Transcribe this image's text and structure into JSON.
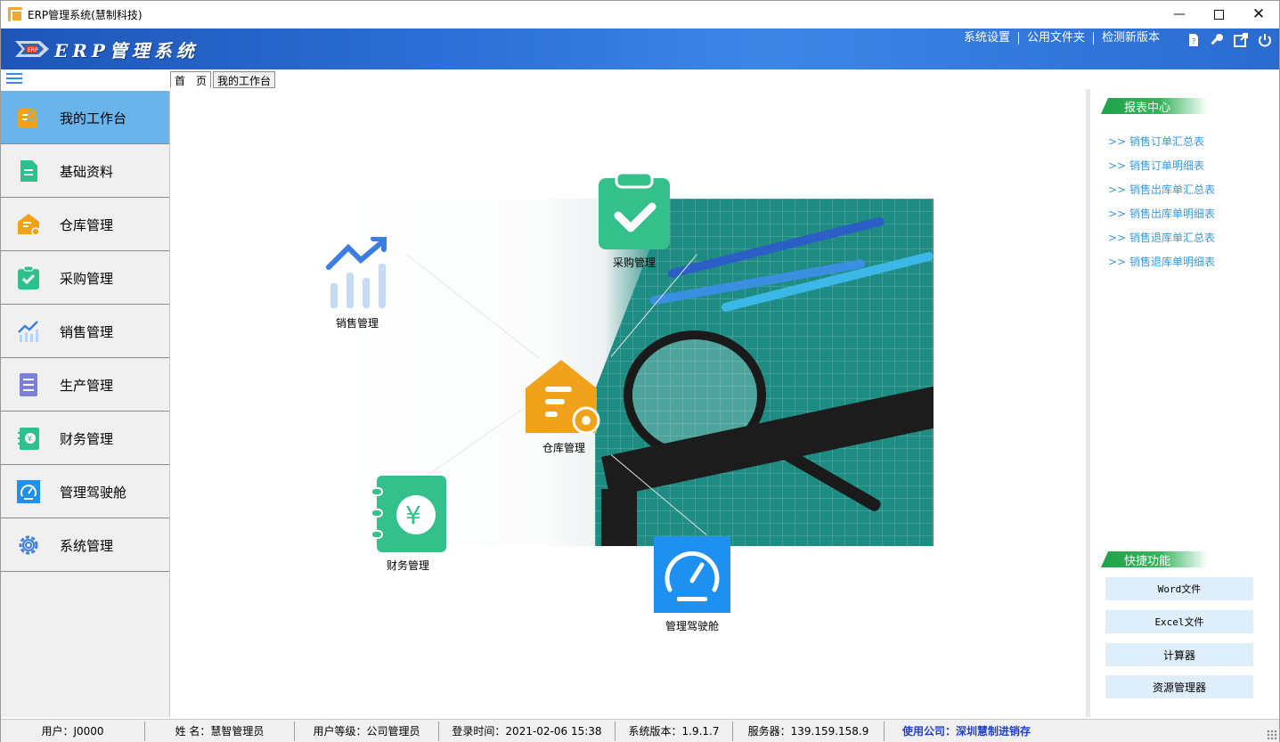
{
  "window": {
    "title": "ERP管理系统(慧制科技)"
  },
  "header": {
    "brand": "ERP管理系统",
    "links": [
      "系统设置",
      "公用文件夹",
      "检测新版本"
    ],
    "icons": [
      "help-icon",
      "key-icon",
      "export-icon",
      "power-icon"
    ]
  },
  "tabs": [
    {
      "label": "首　页",
      "active": true
    },
    {
      "label": "我的工作台",
      "active": false
    }
  ],
  "sidebar": {
    "items": [
      {
        "label": "我的工作台",
        "icon": "workbench-icon",
        "active": true
      },
      {
        "label": "基础资料",
        "icon": "document-icon"
      },
      {
        "label": "仓库管理",
        "icon": "warehouse-icon"
      },
      {
        "label": "采购管理",
        "icon": "clipboard-check-icon"
      },
      {
        "label": "销售管理",
        "icon": "sales-chart-icon"
      },
      {
        "label": "生产管理",
        "icon": "production-list-icon"
      },
      {
        "label": "财务管理",
        "icon": "finance-book-icon"
      },
      {
        "label": "管理驾驶舱",
        "icon": "dashboard-gauge-icon"
      },
      {
        "label": "系统管理",
        "icon": "gear-icon"
      }
    ]
  },
  "modules": {
    "sales": "销售管理",
    "purchase": "采购管理",
    "warehouse": "仓库管理",
    "finance": "财务管理",
    "cockpit": "管理驾驶舱"
  },
  "reports": {
    "title": "报表中心",
    "items": [
      "销售订单汇总表",
      "销售订单明细表",
      "销售出库单汇总表",
      "销售出库单明细表",
      "销售退库单汇总表",
      "销售退库单明细表"
    ],
    "prefix": ">>"
  },
  "quick": {
    "title": "快捷功能",
    "items": [
      "Word文件",
      "Excel文件",
      "计算器",
      "资源管理器"
    ]
  },
  "status": {
    "user": "用户：J0000",
    "name": "姓 名：慧智管理员",
    "level": "用户等级：公司管理员",
    "login": "登录时间：2021-02-06 15:38",
    "version": "系统版本：1.9.1.7",
    "server": "服务器：139.159.158.9",
    "company": "使用公司：深圳慧制进销存"
  },
  "colors": {
    "accent": "#3b98d8",
    "sidebar_active": "#6ab4ec",
    "banner": "#2c6fd6",
    "green": "#34b55a",
    "teal": "#2fbf8c",
    "orange": "#f0a21a",
    "cockpit_blue": "#1e90f0"
  }
}
